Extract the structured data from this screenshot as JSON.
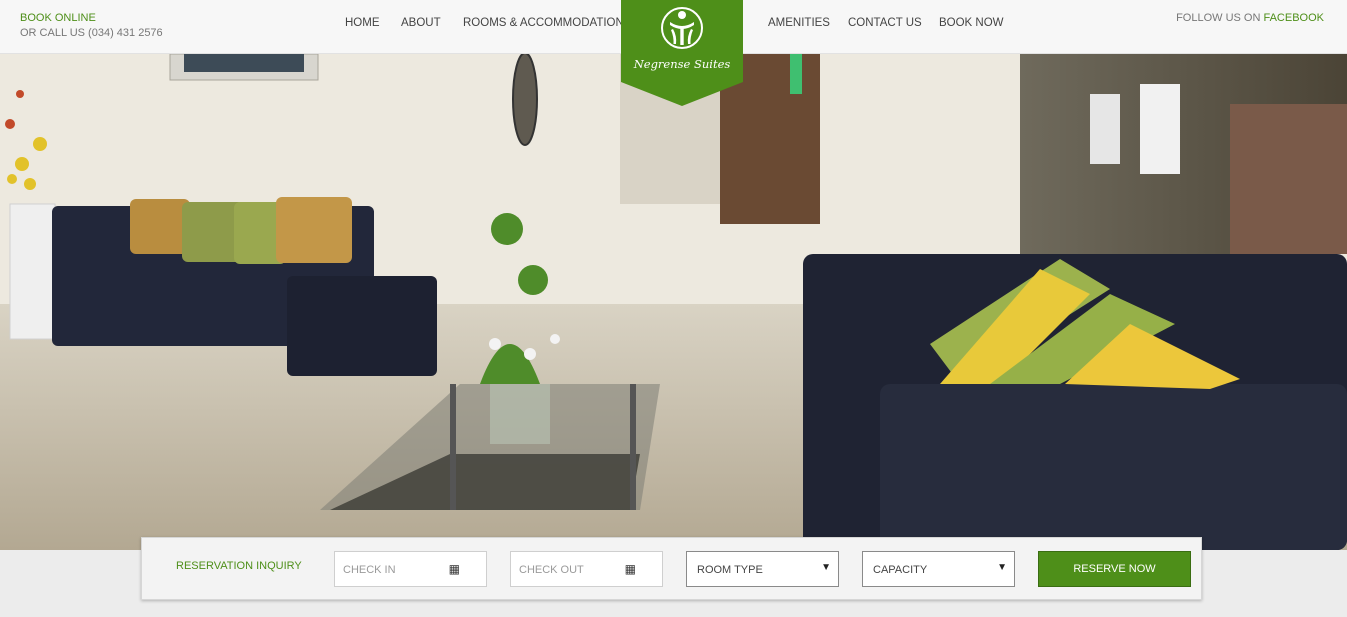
{
  "header": {
    "book_online": "BOOK ONLINE",
    "call_us": "OR CALL US (034) 431 2576",
    "nav_left": [
      "HOME",
      "ABOUT",
      "ROOMS & ACCOMMODATION"
    ],
    "nav_right": [
      "AMENITIES",
      "CONTACT US",
      "BOOK NOW"
    ],
    "follow_prefix": "FOLLOW US ON",
    "follow_link": "FACEBOOK"
  },
  "logo": {
    "name": "Negrense Suites",
    "color": "#4e8f19"
  },
  "reservation": {
    "title": "RESERVATION INQUIRY",
    "check_in_placeholder": "CHECK IN",
    "check_out_placeholder": "CHECK OUT",
    "room_type": "ROOM TYPE",
    "capacity": "CAPACITY",
    "reserve_label": "RESERVE NOW"
  },
  "icons": {
    "calendar": "calendar-icon",
    "dropdown": "chevron-down-icon",
    "calendar_glyph": "▦",
    "caret_glyph": "▼"
  },
  "colors": {
    "accent": "#4e8f19",
    "header_bg": "#f7f7f7"
  }
}
